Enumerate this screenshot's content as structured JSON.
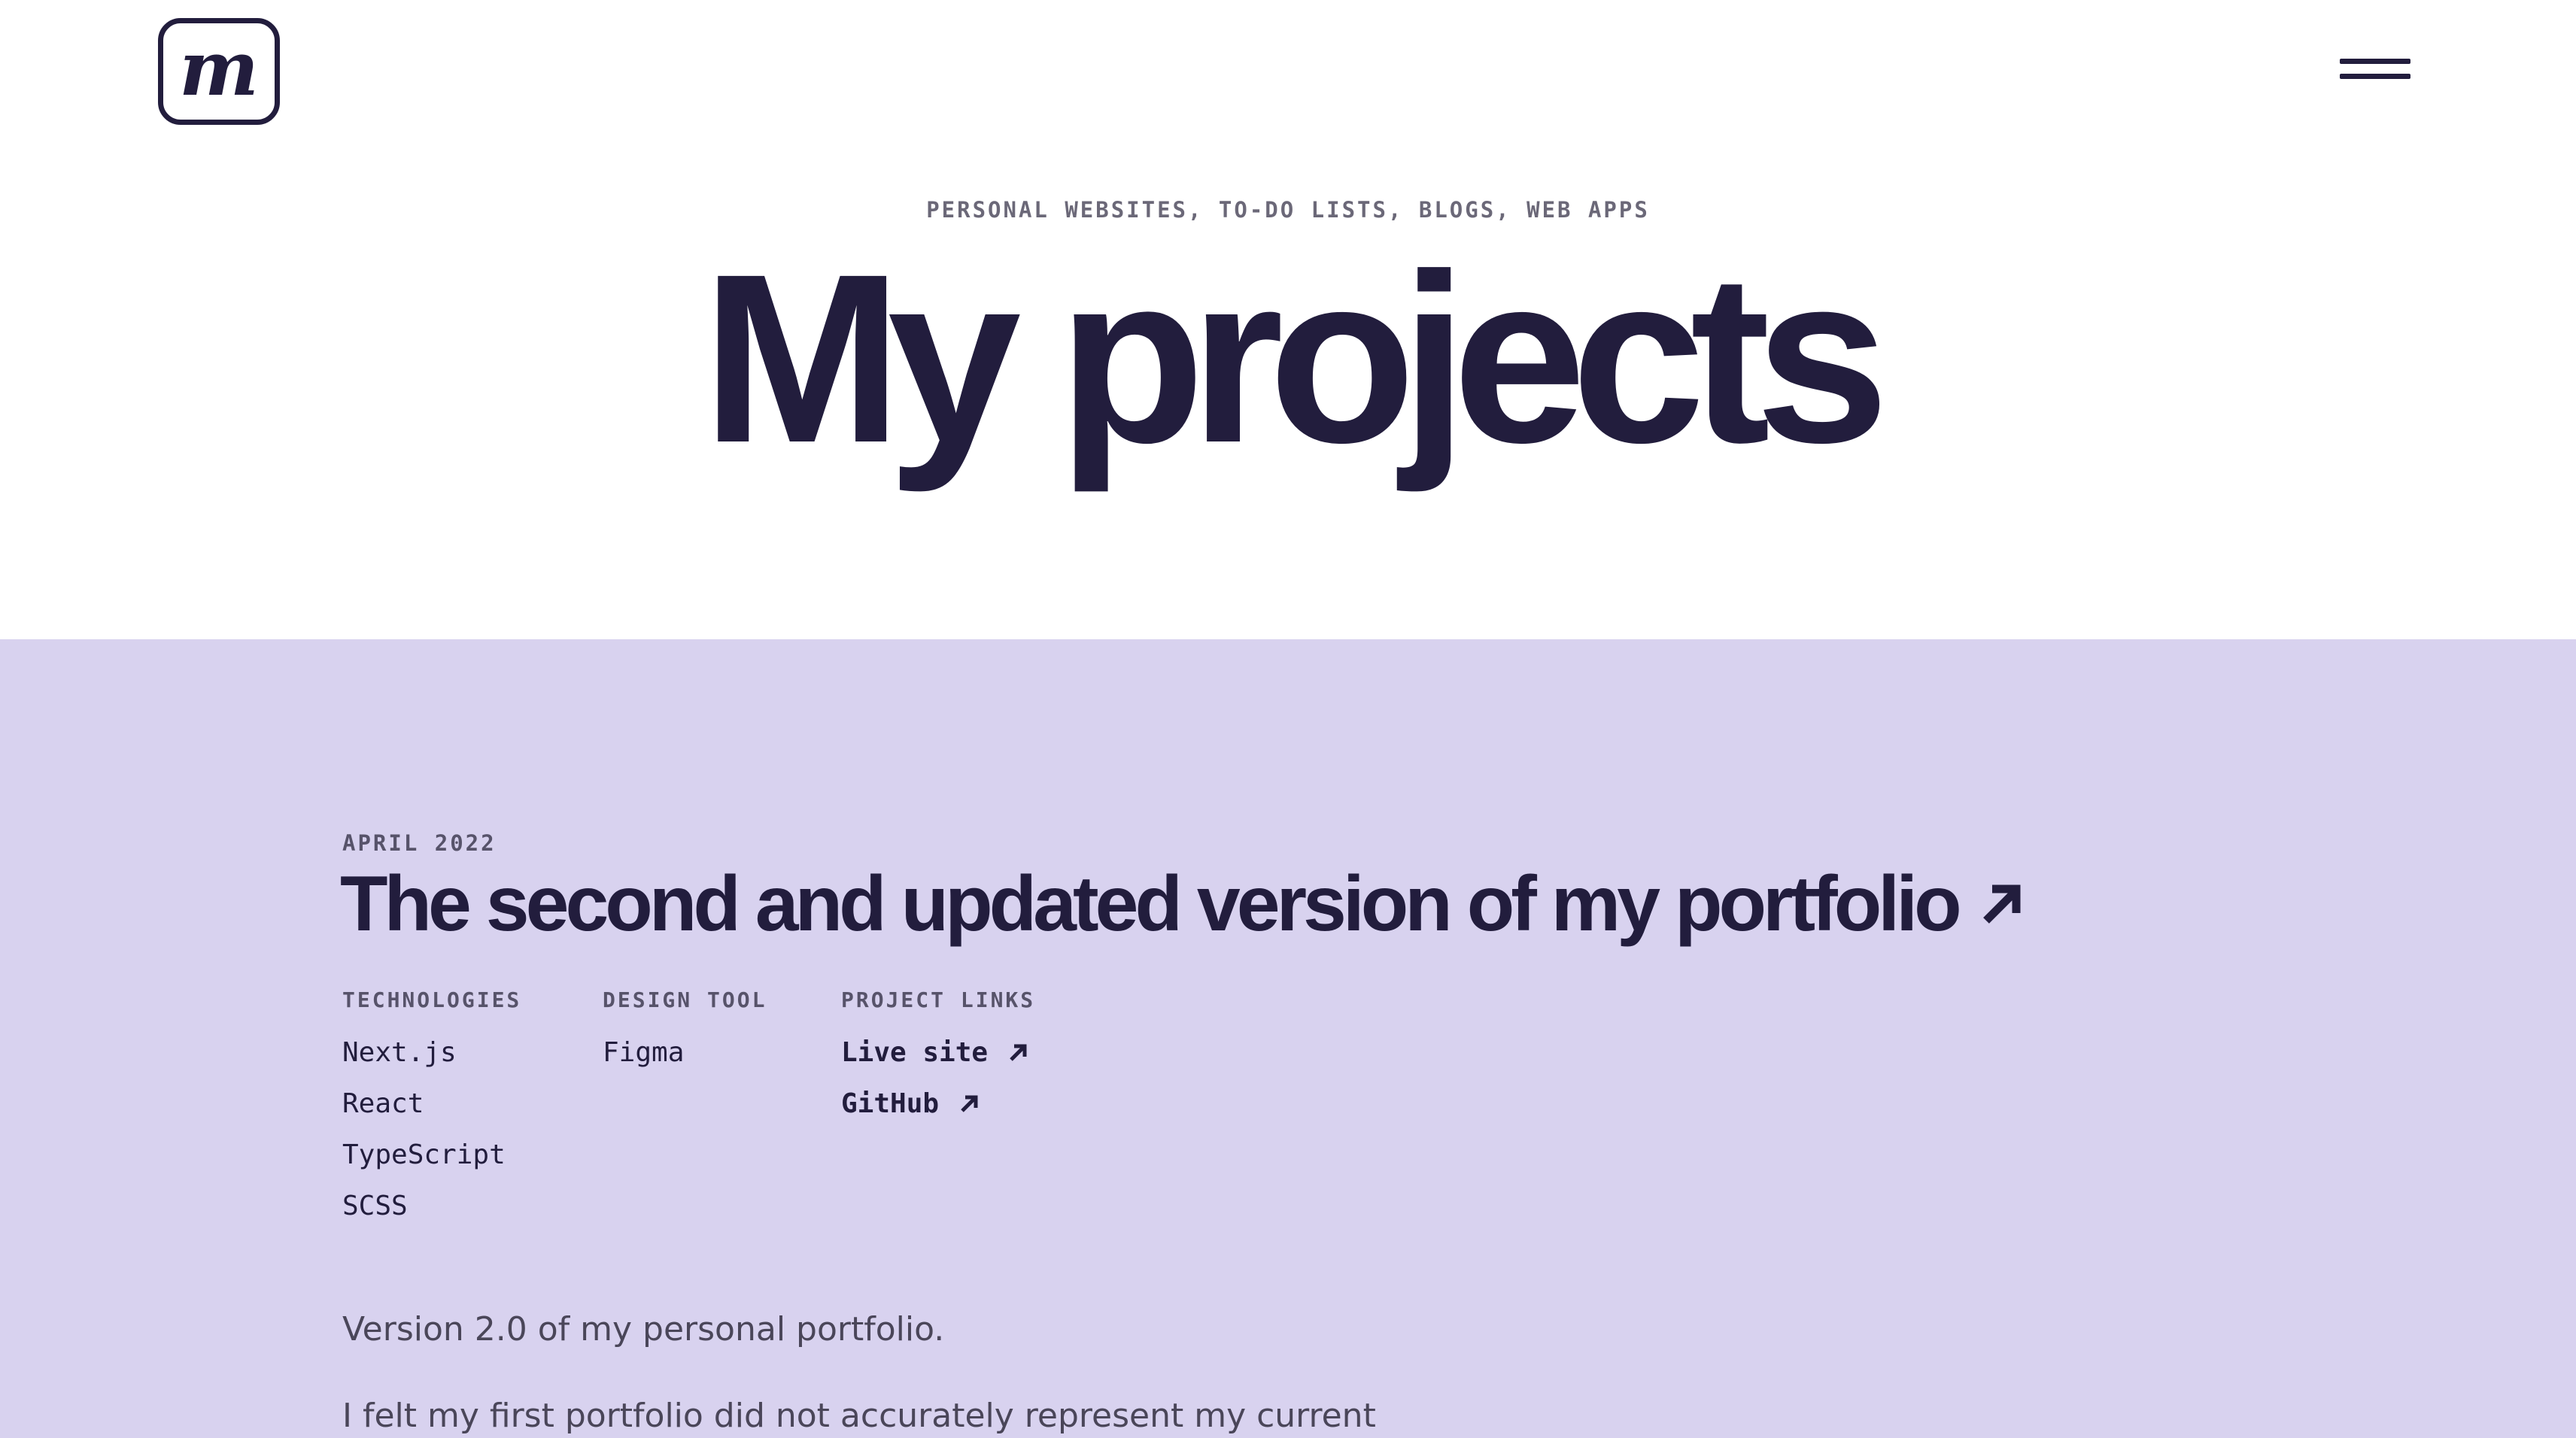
{
  "header": {
    "logo_letter": "m",
    "menu_icon": "hamburger-menu-icon"
  },
  "hero": {
    "eyebrow": "PERSONAL WEBSITES, TO-DO LISTS, BLOGS, WEB APPS",
    "title": "My projects"
  },
  "project": {
    "date": "APRIL 2022",
    "title": "The second and updated version of my portfolio",
    "title_icon": "arrow-up-right-icon",
    "technologies": {
      "heading": "TECHNOLOGIES",
      "items": [
        "Next.js",
        "React",
        "TypeScript",
        "SCSS"
      ]
    },
    "design_tool": {
      "heading": "DESIGN TOOL",
      "items": [
        "Figma"
      ]
    },
    "links": {
      "heading": "PROJECT LINKS",
      "items": [
        "Live site",
        "GitHub"
      ]
    },
    "description": [
      "Version 2.0 of my personal portfolio.",
      "I felt my first portfolio did not accurately represent my current"
    ]
  },
  "colors": {
    "background": "#ffffff",
    "section_background": "#d8d2ef",
    "text_primary": "#221d3d",
    "text_muted": "#6b6878"
  }
}
